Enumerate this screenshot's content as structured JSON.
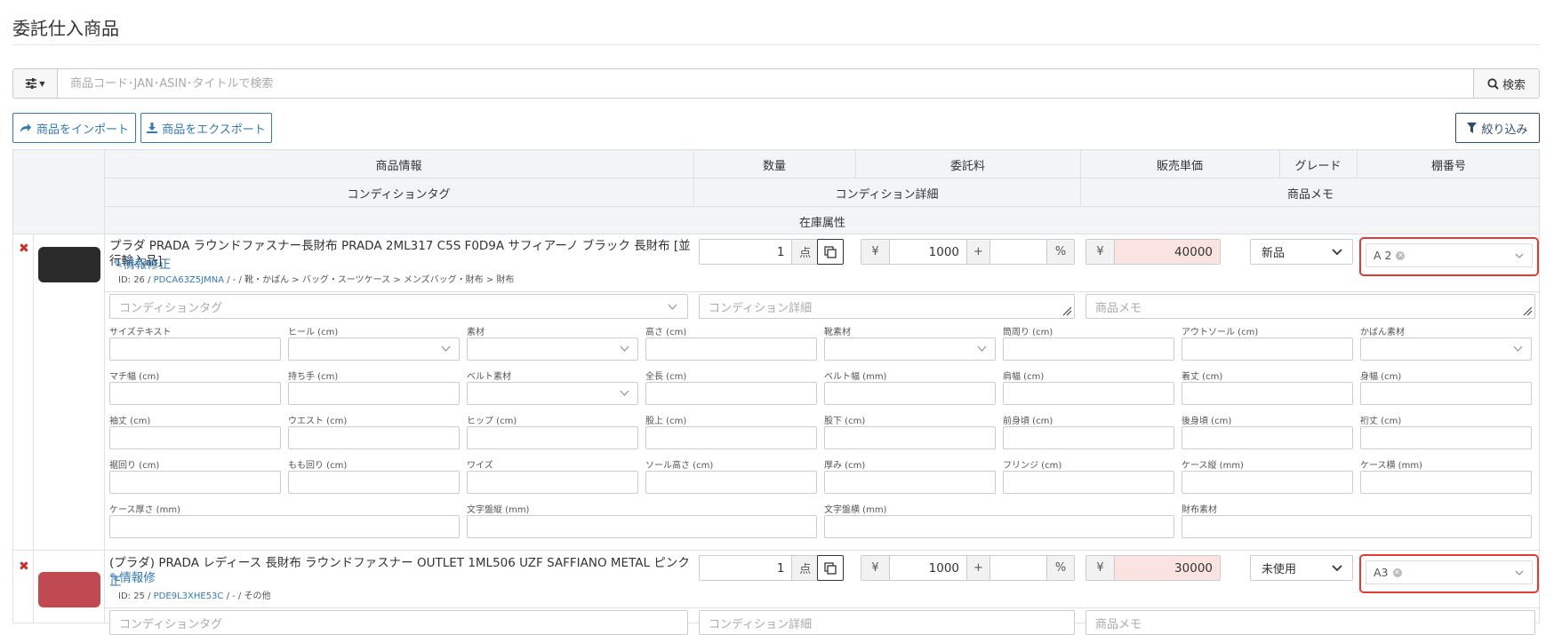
{
  "page": {
    "title": "委託仕入商品"
  },
  "search": {
    "placeholder": "商品コード･JAN･ASIN･タイトルで検索",
    "button_label": "検索",
    "filter_menu_icon": "sliders-icon"
  },
  "toolbar": {
    "import_label": "商品をインポート",
    "export_label": "商品をエクスポート",
    "filter_label": "絞り込み"
  },
  "table": {
    "headers": {
      "product_info": "商品情報",
      "quantity": "数量",
      "commission": "委託料",
      "unit_price": "販売単価",
      "grade": "グレード",
      "shelf": "棚番号",
      "condition_tag": "コンディションタグ",
      "condition_detail": "コンディション詳細",
      "product_memo": "商品メモ",
      "stock_attr": "在庫属性"
    },
    "quantity_unit": "点",
    "yen_symbol": "¥",
    "plus_symbol": "+",
    "percent_symbol": "%",
    "condition_tag_placeholder": "コンディションタグ",
    "condition_detail_placeholder": "コンディション詳細",
    "product_memo_placeholder": "商品メモ"
  },
  "rows": [
    {
      "title": "プラダ PRADA ラウンドファスナー長財布 PRADA 2ML317 C5S F0D9A サフィアーノ ブラック 長財布 [並行輸入品]",
      "edit_label": "情報修正",
      "id_prefix": "ID: 26 / ",
      "code": "PDCA63Z5JMNA",
      "category": " / - / 靴・かばん > バッグ・スーツケース > メンズバッグ・財布 > 財布",
      "quantity": "1",
      "commission": "1000",
      "commission_pct": "",
      "price": "40000",
      "grade": "新品",
      "shelf": "A 2",
      "thumb_color": "#2b2b2b"
    },
    {
      "title": "(プラダ) PRADA レディース 長財布 ラウンドファスナー OUTLET 1ML506 UZF SAFFIANO METAL ピンク",
      "edit_label": "情報修",
      "edit_label_cont": "正",
      "id_prefix": "ID: 25 / ",
      "code": "PDE9L3XHE53C",
      "category": " / - / その他",
      "quantity": "1",
      "commission": "1000",
      "commission_pct": "",
      "price": "30000",
      "grade": "未使用",
      "shelf": "A3",
      "thumb_color": "#c04a52"
    }
  ],
  "attributes": [
    "サイズテキスト",
    "ヒール (cm)",
    "素材",
    "高さ (cm)",
    "靴素材",
    "筒周り (cm)",
    "アウトソール (cm)",
    "かばん素材",
    "マチ幅 (cm)",
    "持ち手 (cm)",
    "ベルト素材",
    "全長 (cm)",
    "ベルト幅 (mm)",
    "肩幅 (cm)",
    "着丈 (cm)",
    "身幅 (cm)",
    "袖丈 (cm)",
    "ウエスト (cm)",
    "ヒップ (cm)",
    "股上 (cm)",
    "股下 (cm)",
    "前身頃 (cm)",
    "後身頃 (cm)",
    "裄丈 (cm)",
    "裾回り (cm)",
    "もも回り (cm)",
    "ワイズ",
    "ソール高さ (cm)",
    "厚み (cm)",
    "フリンジ (cm)",
    "ケース縦 (mm)",
    "ケース横 (mm)",
    "ケース厚さ (mm)",
    "文字盤縦 (mm)",
    "文字盤横 (mm)",
    "財布素材"
  ]
}
